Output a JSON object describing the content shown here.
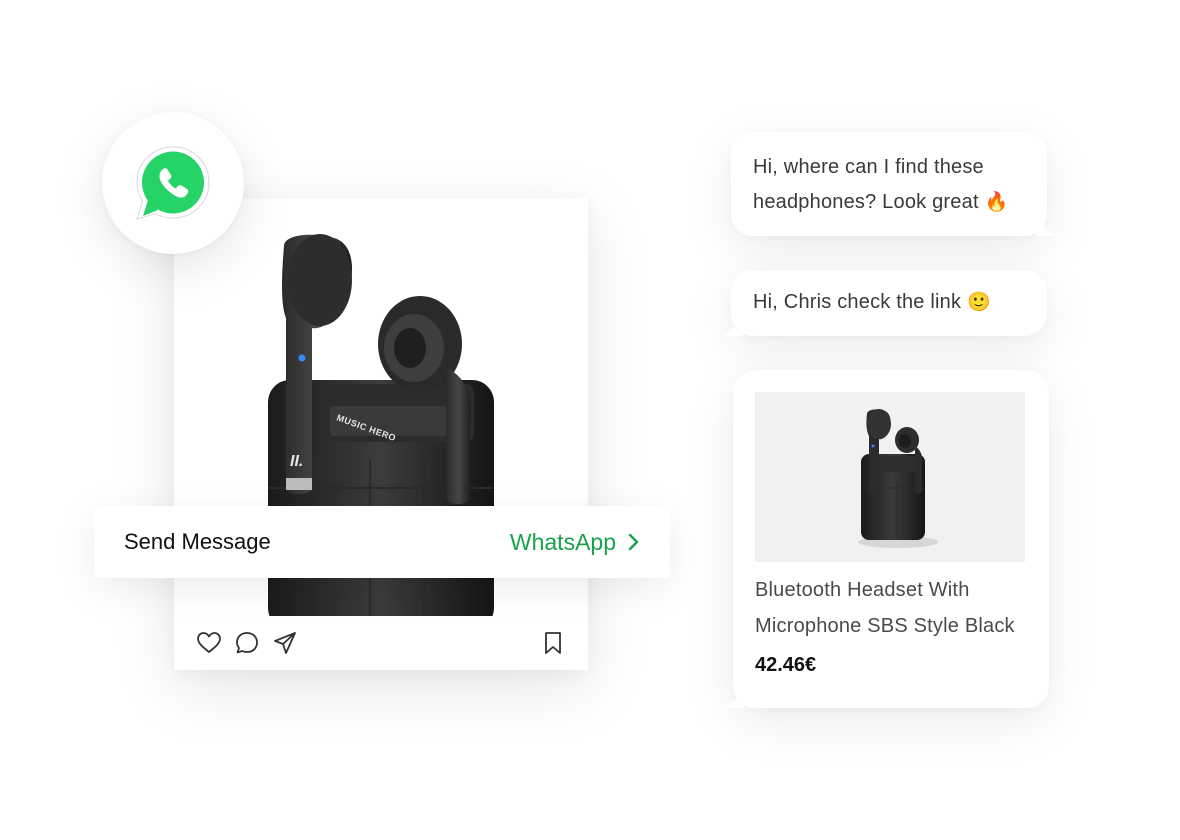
{
  "post": {
    "cta_label": "Send Message",
    "cta_channel": "WhatsApp",
    "action_icons": [
      "heart-icon",
      "comment-icon",
      "share-icon",
      "bookmark-icon"
    ],
    "earbud_brand": "MUSIC HERO"
  },
  "chat": {
    "message_1_line_1": "Hi, where can I find these",
    "message_1_line_2": "headphones? Look great",
    "message_1_emoji": "🔥",
    "message_2_text": "Hi, Chris check the link",
    "message_2_emoji": "🙂"
  },
  "product": {
    "title_line_1": "Bluetooth Headset With",
    "title_line_2": "Microphone SBS Style Black",
    "price": "42.46€"
  },
  "colors": {
    "whatsapp_green": "#25D366",
    "cta_green": "#16a34a",
    "card_bg": "#ffffff",
    "product_bg": "#f1f1f1"
  }
}
